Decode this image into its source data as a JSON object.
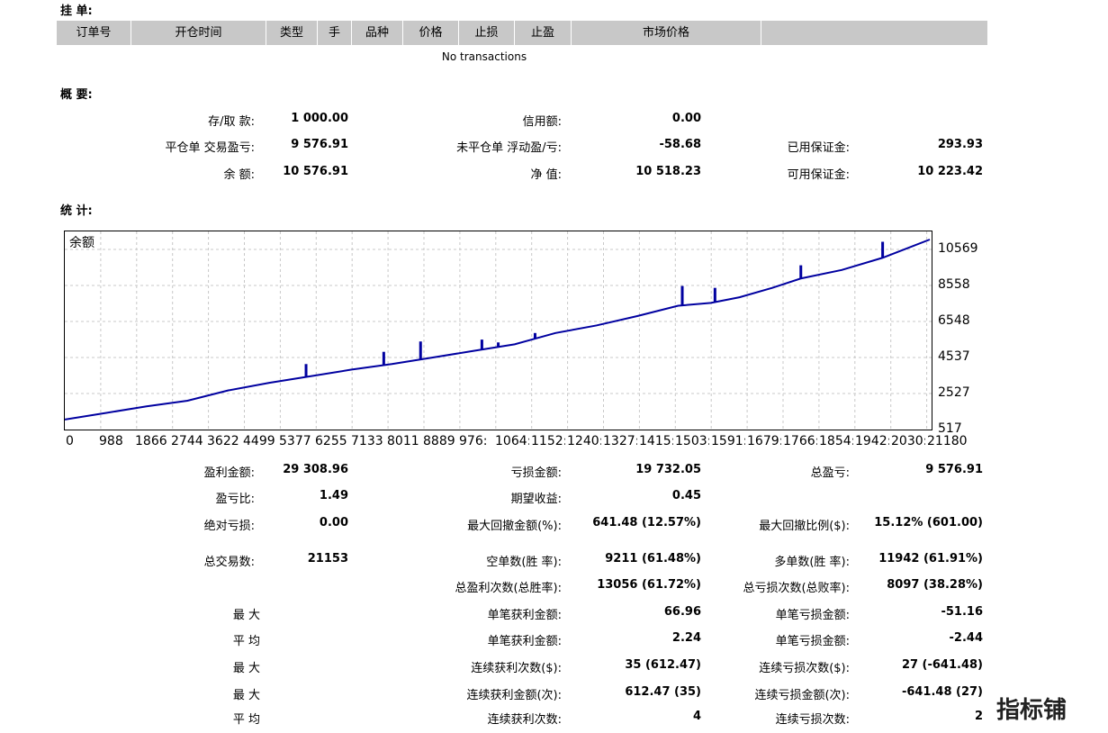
{
  "pending": {
    "title": "挂 单:",
    "columns": [
      "订单号",
      "开仓时间",
      "类型",
      "手",
      "品种",
      "价格",
      "止损",
      "止盈",
      "市场价格",
      ""
    ],
    "empty": "No transactions"
  },
  "summary": {
    "title": "概 要:",
    "rows": [
      [
        {
          "label": "存/取 款:",
          "value": "1 000.00"
        },
        {
          "label": "信用额:",
          "value": "0.00"
        },
        {
          "label": "",
          "value": ""
        }
      ],
      [
        {
          "label": "平仓单 交易盈亏:",
          "value": "9 576.91"
        },
        {
          "label": "未平仓单 浮动盈/亏:",
          "value": "-58.68"
        },
        {
          "label": "已用保证金:",
          "value": "293.93"
        }
      ],
      [
        {
          "label": "余 额:",
          "value": "10 576.91"
        },
        {
          "label": "净 值:",
          "value": "10 518.23"
        },
        {
          "label": "可用保证金:",
          "value": "10 223.42"
        }
      ]
    ]
  },
  "stats": {
    "title": "统 计:",
    "rows": [
      [
        {
          "label": "盈利金额:",
          "value": "29 308.96"
        },
        {
          "label": "亏损金额:",
          "value": "19 732.05"
        },
        {
          "label": "总盈亏:",
          "value": "9 576.91"
        }
      ],
      [
        {
          "label": "盈亏比:",
          "value": "1.49"
        },
        {
          "label": "期望收益:",
          "value": "0.45"
        },
        {
          "label": "",
          "value": ""
        }
      ],
      [
        {
          "label": "绝对亏损:",
          "value": "0.00"
        },
        {
          "label": "最大回撤金额(%):",
          "value": "641.48 (12.57%)"
        },
        {
          "label": "最大回撤比例($):",
          "value": "15.12% (601.00)"
        }
      ],
      [
        {
          "label": "总交易数:",
          "value": "21153"
        },
        {
          "label": "空单数(胜 率):",
          "value": "9211 (61.48%)"
        },
        {
          "label": "多单数(胜 率):",
          "value": "11942 (61.91%)"
        }
      ],
      [
        {
          "label": "",
          "value": ""
        },
        {
          "label": "总盈利次数(总胜率):",
          "value": "13056 (61.72%)"
        },
        {
          "label": "总亏损次数(总败率):",
          "value": "8097 (38.28%)"
        }
      ],
      [
        {
          "label": "最 大",
          "value": ""
        },
        {
          "label": "单笔获利金额:",
          "value": "66.96"
        },
        {
          "label": "单笔亏损金额:",
          "value": "-51.16"
        }
      ],
      [
        {
          "label": "平 均",
          "value": ""
        },
        {
          "label": "单笔获利金额:",
          "value": "2.24"
        },
        {
          "label": "单笔亏损金额:",
          "value": "-2.44"
        }
      ],
      [
        {
          "label": "最 大",
          "value": ""
        },
        {
          "label": "连续获利次数($):",
          "value": "35 (612.47)"
        },
        {
          "label": "连续亏损次数($):",
          "value": "27 (-641.48)"
        }
      ],
      [
        {
          "label": "最 大",
          "value": ""
        },
        {
          "label": "连续获利金额(次):",
          "value": "612.47 (35)"
        },
        {
          "label": "连续亏损金额(次):",
          "value": "-641.48 (27)"
        }
      ],
      [
        {
          "label": "平 均",
          "value": ""
        },
        {
          "label": "连续获利次数:",
          "value": "4"
        },
        {
          "label": "连续亏损次数:",
          "value": "2"
        }
      ]
    ]
  },
  "watermark": "指标铺",
  "chart_data": {
    "type": "line",
    "series_label": "余额",
    "color": "#0000a0",
    "grid": true,
    "x_ticks": [
      "0",
      "988",
      "1866",
      "2744",
      "3622",
      "4499",
      "5377",
      "6255",
      "7133",
      "8011",
      "8889",
      "976:",
      "1064:",
      "1152:",
      "1240:",
      "1327:",
      "1415:",
      "1503:",
      "1591:",
      "1679:",
      "1766:",
      "1854:",
      "1942:",
      "2030:",
      "21180"
    ],
    "y_ticks": [
      "10569",
      "8558",
      "6548",
      "4537",
      "2527",
      "517"
    ],
    "xlim": [
      0,
      21153
    ],
    "ylim": [
      517,
      11000
    ],
    "points": [
      [
        0,
        1000
      ],
      [
        1000,
        1350
      ],
      [
        2000,
        1700
      ],
      [
        3000,
        2000
      ],
      [
        4000,
        2550
      ],
      [
        5000,
        2950
      ],
      [
        6000,
        3300
      ],
      [
        7000,
        3650
      ],
      [
        8000,
        3950
      ],
      [
        9000,
        4300
      ],
      [
        10000,
        4650
      ],
      [
        11000,
        5000
      ],
      [
        12000,
        5600
      ],
      [
        13000,
        6000
      ],
      [
        14000,
        6500
      ],
      [
        15000,
        7050
      ],
      [
        15800,
        7200
      ],
      [
        16500,
        7500
      ],
      [
        17300,
        8000
      ],
      [
        18000,
        8500
      ],
      [
        19000,
        8950
      ],
      [
        20000,
        9600
      ],
      [
        21153,
        10569
      ]
    ],
    "spikes": [
      [
        5900,
        3950
      ],
      [
        7800,
        4600
      ],
      [
        8700,
        5150
      ],
      [
        10200,
        5250
      ],
      [
        10600,
        5100
      ],
      [
        11500,
        5600
      ],
      [
        15100,
        8100
      ],
      [
        15900,
        8000
      ],
      [
        18000,
        9200
      ],
      [
        20000,
        10450
      ]
    ]
  }
}
